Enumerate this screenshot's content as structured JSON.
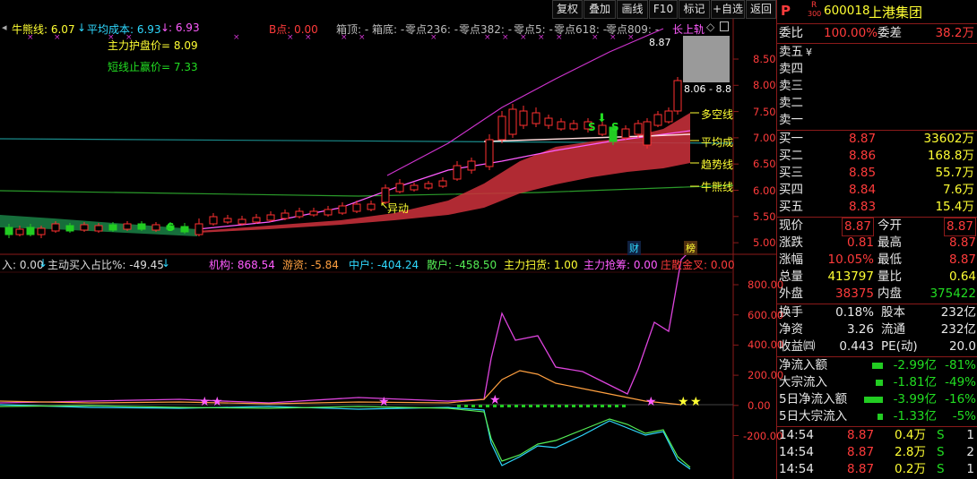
{
  "toolbar": {
    "buttons": [
      "复权",
      "叠加",
      "画线",
      "F10",
      "标记",
      "+自选",
      "返回"
    ]
  },
  "stock": {
    "badge": "P",
    "subbadge_top": "R",
    "subbadge_bottom": "300",
    "code": "600018",
    "name": "上港集团"
  },
  "indicator_bar": {
    "niuqian": "牛熊线: 6.07",
    "pingjun": "平均成本: 6.93",
    "colon_val": ": 6.93",
    "bdian": "B点: 0.00",
    "xiangding": "箱顶: -",
    "xiangdi": "箱底: -",
    "lingdian236": "零点236: -",
    "lingdian382": "零点382: -",
    "lingdian5": "零点5: -",
    "lingdian618": "零点618: -",
    "lingdian809": "零点809: -",
    "upper_rail": "长上轨",
    "zhuli_hupan": "主力护盘价= 8.09",
    "duanxian_zhiying": "短线止赢价= 7.33"
  },
  "price_axis": [
    "8.50",
    "8.00",
    "7.50",
    "7.00",
    "6.50",
    "6.00",
    "5.50",
    "5.00"
  ],
  "line_labels": {
    "duokong": "多空线",
    "pingjun": "平均成",
    "qushi": "趋势线",
    "niuxiong": "牛熊线",
    "yidong": "异动",
    "price_high": "8.87",
    "price_range": "8.06 - 8.8"
  },
  "event_markers": {
    "cai": "财",
    "bang": "榜"
  },
  "sub_indicator": {
    "zhudong_in": "入: 0.00",
    "zhudong_ratio": "主动买入占比%: -49.45",
    "jigou": "机构: 868.54",
    "youzi": "游资: -5.84",
    "zhonghu": "中户: -404.24",
    "sanhu": "散户: -458.50",
    "zhuli_saohuo": "主力扫货: 1.00",
    "zhuli_qiangchou": "主力抢筹: 0.00",
    "zhuangou": "庄散金叉: 0.00"
  },
  "sub_axis": [
    "800.00",
    "600.00",
    "400.00",
    "200.00",
    "0.00",
    "-200.00"
  ],
  "panel": {
    "weibi_label": "委比",
    "weibi_value": "100.00%",
    "weicha_label": "委差",
    "weicha_value": "38.2万",
    "sell": [
      {
        "label": "卖五",
        "mark": "¥",
        "price": "",
        "vol": ""
      },
      {
        "label": "卖四",
        "mark": "",
        "price": "",
        "vol": ""
      },
      {
        "label": "卖三",
        "mark": "",
        "price": "",
        "vol": ""
      },
      {
        "label": "卖二",
        "mark": "",
        "price": "",
        "vol": ""
      },
      {
        "label": "卖一",
        "mark": "",
        "price": "",
        "vol": ""
      }
    ],
    "buy": [
      {
        "label": "买一",
        "price": "8.87",
        "vol": "33602万"
      },
      {
        "label": "买二",
        "price": "8.86",
        "vol": "168.8万"
      },
      {
        "label": "买三",
        "price": "8.85",
        "vol": "55.7万"
      },
      {
        "label": "买四",
        "price": "8.84",
        "vol": "7.6万"
      },
      {
        "label": "买五",
        "price": "8.83",
        "vol": "15.4万"
      }
    ],
    "stats": [
      {
        "l1": "现价",
        "v1": "8.87",
        "c1": "red",
        "b1": true,
        "l2": "今开",
        "v2": "8.87",
        "c2": "red",
        "b2": true
      },
      {
        "l1": "涨跌",
        "v1": "0.81",
        "c1": "red",
        "b1": false,
        "l2": "最高",
        "v2": "8.87",
        "c2": "red",
        "b2": false
      },
      {
        "l1": "涨幅",
        "v1": "10.05%",
        "c1": "red",
        "b1": false,
        "l2": "最低",
        "v2": "8.87",
        "c2": "red",
        "b2": false
      },
      {
        "l1": "总量",
        "v1": "413797",
        "c1": "yel",
        "b1": false,
        "l2": "量比",
        "v2": "0.64",
        "c2": "yel",
        "b2": false
      },
      {
        "l1": "外盘",
        "v1": "38375",
        "c1": "red",
        "b1": false,
        "l2": "内盘",
        "v2": "375422",
        "c2": "grn",
        "b2": false
      }
    ],
    "stats2": [
      {
        "l1": "换手",
        "v1": "0.18%",
        "l2": "股本",
        "v2": "232亿"
      },
      {
        "l1": "净资",
        "v1": "3.26",
        "l2": "流通",
        "v2": "232亿"
      },
      {
        "l1": "收益㈣",
        "v1": "0.443",
        "l2": "PE(动)",
        "v2": "20.0"
      }
    ],
    "flows": [
      {
        "label": "净流入额",
        "value": "-2.99亿",
        "pct": "-81%",
        "bar": 0.55
      },
      {
        "label": "大宗流入",
        "value": "-1.81亿",
        "pct": "-49%",
        "bar": 0.35
      },
      {
        "label": "5日净流入额",
        "value": "-3.99亿",
        "pct": "-16%",
        "bar": 0.95
      },
      {
        "label": "5日大宗流入",
        "value": "-1.33亿",
        "pct": "-5%",
        "bar": 0.25
      }
    ],
    "ticks": [
      {
        "time": "14:54",
        "price": "8.87",
        "vol": "0.4万",
        "side": "S",
        "n": "1"
      },
      {
        "time": "14:54",
        "price": "8.87",
        "vol": "2.8万",
        "side": "S",
        "n": "2"
      },
      {
        "time": "14:54",
        "price": "8.87",
        "vol": "0.2万",
        "side": "S",
        "n": "1"
      }
    ]
  }
}
